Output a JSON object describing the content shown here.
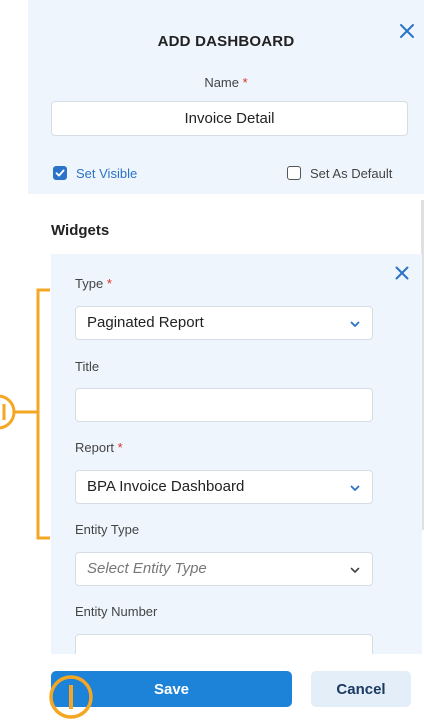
{
  "dialog": {
    "title": "ADD DASHBOARD",
    "name_label": "Name",
    "required_mark": "*",
    "name_value": "Invoice Detail",
    "set_visible_label": "Set Visible",
    "set_visible_checked": true,
    "set_default_label": "Set As Default",
    "set_default_checked": false
  },
  "widgets": {
    "title": "Widgets",
    "type_label": "Type",
    "type_value": "Paginated Report",
    "title_label": "Title",
    "title_value": "",
    "report_label": "Report",
    "report_value": "BPA Invoice Dashboard",
    "entity_type_label": "Entity Type",
    "entity_type_placeholder": "Select Entity Type",
    "entity_number_label": "Entity Number"
  },
  "footer": {
    "save_label": "Save",
    "cancel_label": "Cancel"
  },
  "icons": {
    "close": "close-icon",
    "chevron": "chevron-down-icon",
    "check": "check-icon"
  },
  "colors": {
    "accent": "#1c83d8",
    "header_bg": "#eef5fc",
    "annotation": "#f5a623",
    "required": "#d93025"
  }
}
